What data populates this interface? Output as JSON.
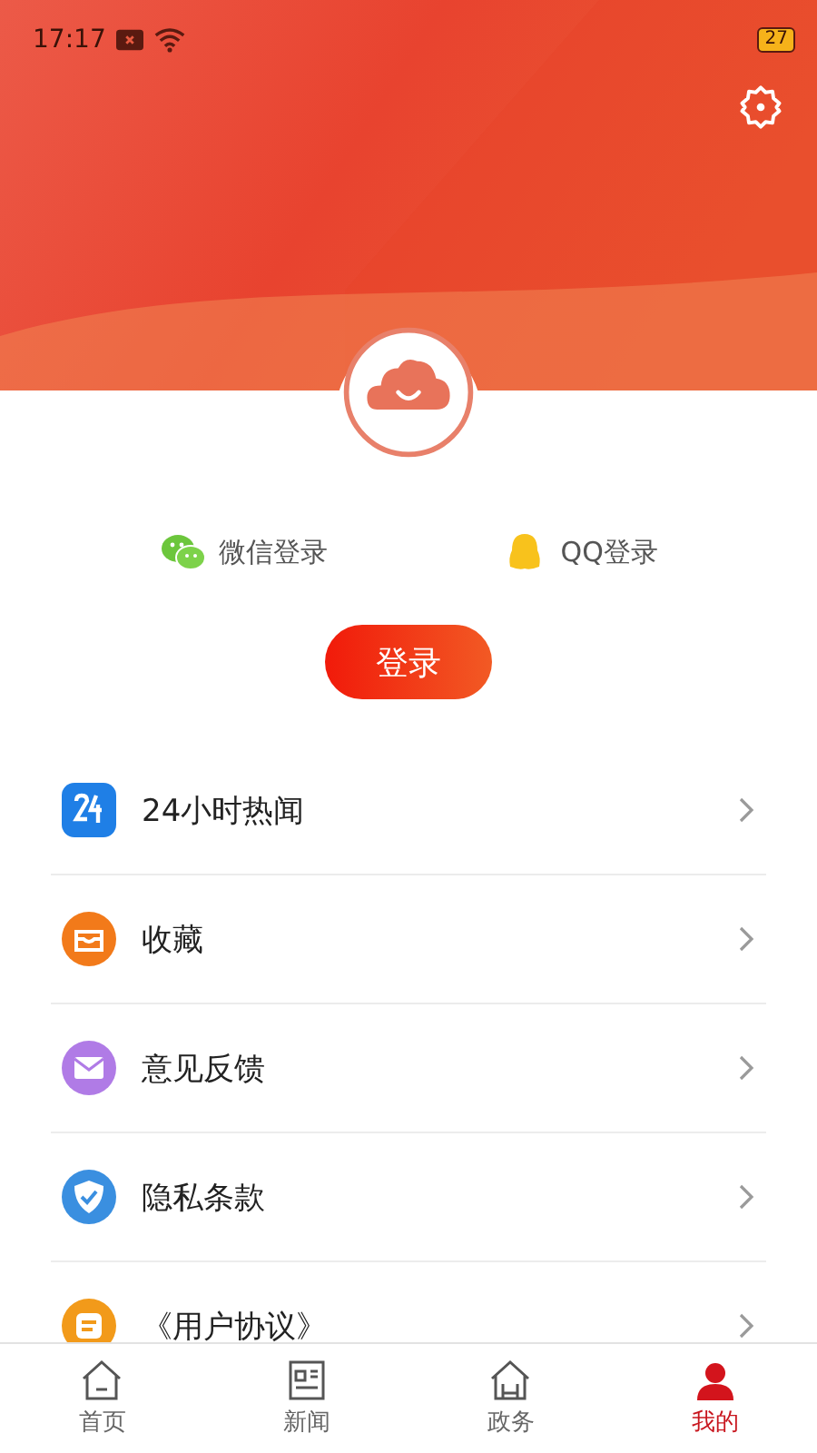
{
  "status_bar": {
    "time": "17:17",
    "battery": "27"
  },
  "social_logins": [
    {
      "label": "微信登录",
      "kind": "wechat"
    },
    {
      "label": "QQ登录",
      "kind": "qq"
    }
  ],
  "login_button": "登录",
  "menu": [
    {
      "label": "24小时热闻",
      "color": "#1f7fe6"
    },
    {
      "label": "收藏",
      "color": "#f27a1a"
    },
    {
      "label": "意见反馈",
      "color": "#b07be6"
    },
    {
      "label": "隐私条款",
      "color": "#3a8fe0"
    },
    {
      "label": "《用户协议》",
      "color": "#f29a1a"
    }
  ],
  "tabs": [
    {
      "label": "首页",
      "selected": false
    },
    {
      "label": "新闻",
      "selected": false
    },
    {
      "label": "政务",
      "selected": false
    },
    {
      "label": "我的",
      "selected": true
    }
  ]
}
